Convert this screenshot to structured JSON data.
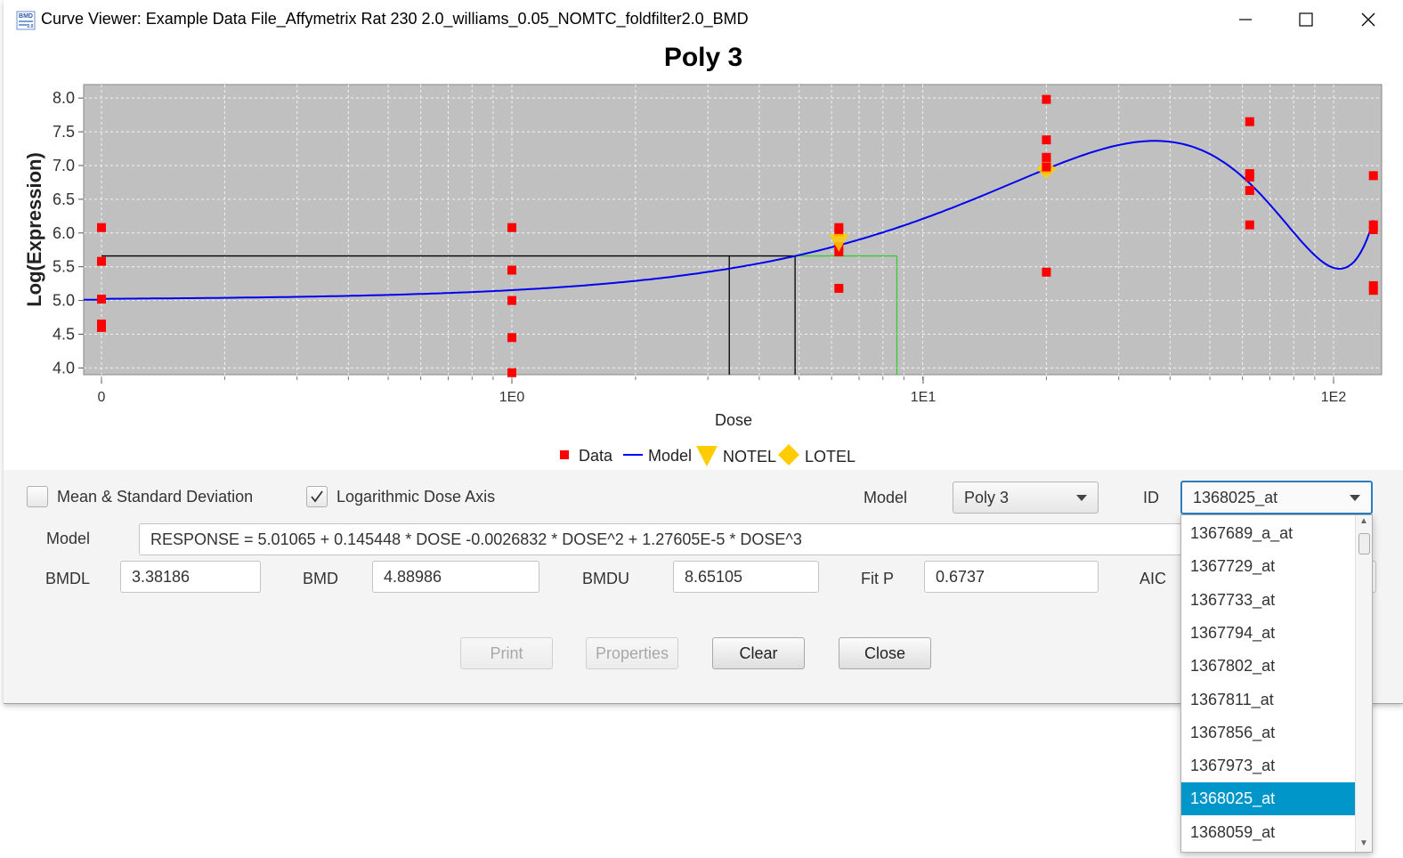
{
  "window": {
    "title": "Curve Viewer: Example Data File_Affymetrix Rat 230 2.0_williams_0.05_NOMTC_foldfilter2.0_BMD",
    "icon_text": "BMD Express 2.0",
    "minimize_icon": "minimize-icon",
    "maximize_icon": "maximize-icon",
    "close_icon": "close-icon"
  },
  "chart_data": {
    "type": "scatter",
    "title": "Poly 3",
    "xlabel": "Dose",
    "ylabel": "Log(Expression)",
    "x_scale": "log",
    "x_tick_labels": [
      "0",
      "1E0",
      "1E1",
      "1E2"
    ],
    "y_ticks": [
      "4.0",
      "4.5",
      "5.0",
      "5.5",
      "6.0",
      "6.5",
      "7.0",
      "7.5",
      "8.0"
    ],
    "ylim": [
      3.9,
      8.2
    ],
    "grid": true,
    "background": "#c0c0c0",
    "legend": [
      {
        "name": "Data",
        "color": "#ff0000",
        "marker": "square"
      },
      {
        "name": "Model",
        "color": "#0000ff",
        "marker": "line"
      },
      {
        "name": "NOTEL",
        "color": "#ffcc00",
        "marker": "triangle-down"
      },
      {
        "name": "LOTEL",
        "color": "#ffcc00",
        "marker": "diamond"
      }
    ],
    "legend_position": "bottom",
    "data_points": [
      {
        "dose": 0,
        "values": [
          6.08,
          5.58,
          5.02,
          4.65,
          4.6
        ]
      },
      {
        "dose": 1,
        "values": [
          6.08,
          5.45,
          5.0,
          4.45,
          3.93
        ]
      },
      {
        "dose": 6.25,
        "values": [
          6.08,
          6.02,
          5.8,
          5.72,
          5.18
        ]
      },
      {
        "dose": 20,
        "values": [
          7.98,
          7.38,
          7.12,
          6.98,
          6.95,
          5.42
        ]
      },
      {
        "dose": 62.5,
        "values": [
          7.65,
          6.88,
          6.83,
          6.63,
          6.12
        ]
      },
      {
        "dose": 125,
        "values": [
          6.85,
          6.12,
          6.05,
          5.22,
          5.15
        ]
      }
    ],
    "model_formula": "RESPONSE = 5.01065 + 0.145448 * DOSE -0.0026832 * DOSE^2 + 1.27605E-5 * DOSE^3",
    "notel": {
      "dose": 6.25,
      "value": 5.88
    },
    "lotel": {
      "dose": 20,
      "value": 6.95
    },
    "bmdl": 3.38186,
    "bmd": 4.88986,
    "bmdu": 8.65105,
    "bmr_response": 5.66
  },
  "controls": {
    "mean_sd_label": "Mean & Standard Deviation",
    "mean_sd_checked": false,
    "log_axis_label": "Logarithmic Dose Axis",
    "log_axis_checked": true,
    "model_label": "Model",
    "model_value": "Poly 3",
    "id_label": "ID",
    "id_value": "1368025_at",
    "formula_label": "Model",
    "formula_value": "RESPONSE = 5.01065 + 0.145448 * DOSE -0.0026832 * DOSE^2 + 1.27605E-5 * DOSE^3",
    "bmdl_label": "BMDL",
    "bmdl_value": "3.38186",
    "bmd_label": "BMD",
    "bmd_value": "4.88986",
    "bmdu_label": "BMDU",
    "bmdu_value": "8.65105",
    "fitp_label": "Fit P",
    "fitp_value": "0.6737",
    "aic_label": "AIC"
  },
  "buttons": {
    "print": "Print",
    "properties": "Properties",
    "clear": "Clear",
    "close": "Close"
  },
  "dropdown": {
    "items": [
      "1367689_a_at",
      "1367729_at",
      "1367733_at",
      "1367794_at",
      "1367802_at",
      "1367811_at",
      "1367856_at",
      "1367973_at",
      "1368025_at",
      "1368059_at"
    ],
    "selected_index": 8
  }
}
